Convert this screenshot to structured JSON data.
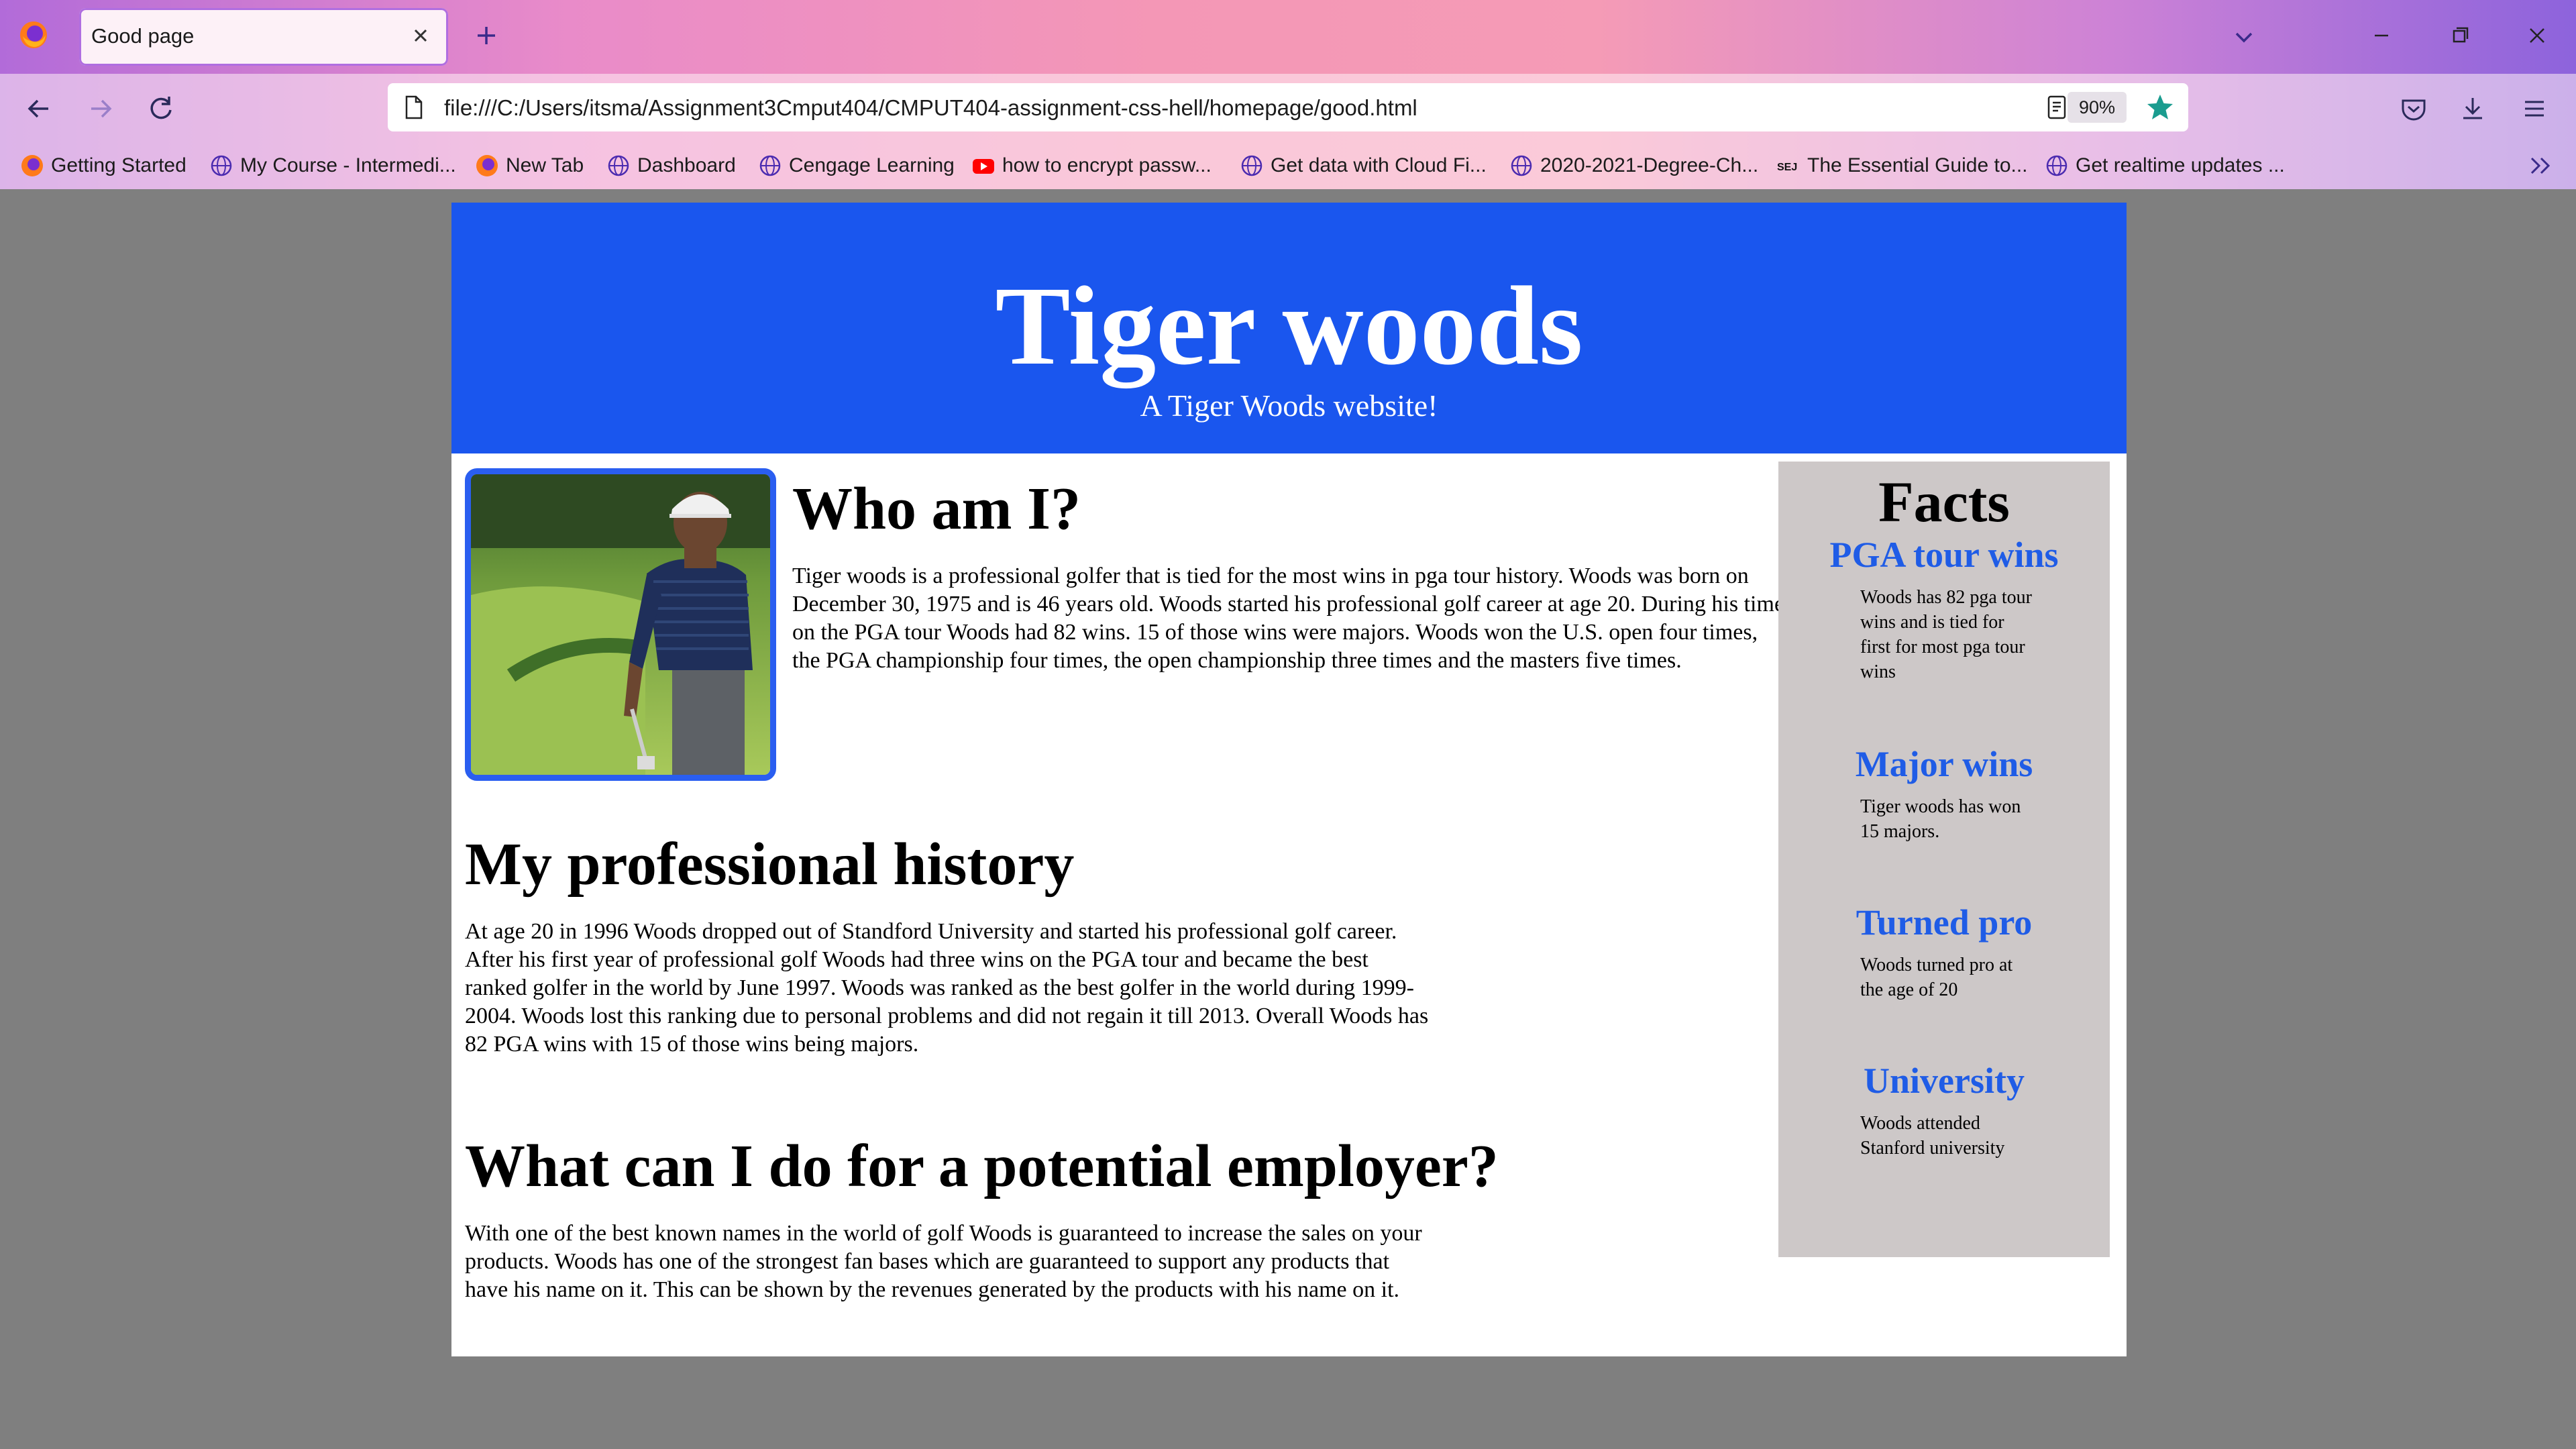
{
  "browser": {
    "tab_title": "Good page",
    "url": "file:///C:/Users/itsma/Assignment3Cmput404/CMPUT404-assignment-css-hell/homepage/good.html",
    "zoom": "90%",
    "bookmarks": [
      {
        "label": "Getting Started",
        "icon": "firefox-icon"
      },
      {
        "label": "My Course - Intermedi...",
        "icon": "globe-icon"
      },
      {
        "label": "New Tab",
        "icon": "firefox-icon"
      },
      {
        "label": "Dashboard",
        "icon": "globe-icon"
      },
      {
        "label": "Cengage Learning",
        "icon": "globe-icon"
      },
      {
        "label": "how to encrypt passw...",
        "icon": "youtube-icon"
      },
      {
        "label": "Get data with Cloud Fi...",
        "icon": "globe-icon"
      },
      {
        "label": "2020-2021-Degree-Ch...",
        "icon": "globe-icon"
      },
      {
        "label": "The Essential Guide to...",
        "icon": "sej-icon"
      },
      {
        "label": "Get realtime updates ...",
        "icon": "globe-icon"
      }
    ],
    "sej_glyph": "SEJ",
    "accent_colors": {
      "star": "#1a9c8f",
      "tab_outline": "#b06ee0"
    }
  },
  "page": {
    "header": {
      "title": "Tiger woods",
      "subtitle": "A Tiger Woods website!",
      "background": "#1a56ee"
    },
    "who": {
      "title": "Who am I?",
      "text": "Tiger woods is a professional golfer that is tied for the most wins in pga tour history. Woods was born on December 30, 1975 and is 46 years old. Woods started his professional golf career at age 20. During his time on the PGA tour Woods had 82 wins. 15 of those wins were majors. Woods won the U.S. open four times, the PGA championship four times, the open championship three times and the masters five times."
    },
    "history": {
      "title": "My professional history",
      "text": "At age 20 in 1996 Woods dropped out of Standford University and started his professional golf career. After his first year of professional golf Woods had three wins on the PGA tour and became the best ranked golfer in the world by June 1997. Woods was ranked as the best golfer in the world during 1999-2004. Woods lost this ranking due to personal problems and did not regain it till 2013. Overall Woods has 82 PGA wins with 15 of those wins being majors."
    },
    "employer": {
      "title": "What can I do for a potential employer?",
      "text": "With one of the best known names in the world of golf Woods is guaranteed to increase the sales on your products. Woods has one of the strongest fan bases which are guaranteed to support any products that have his name on it. This can be shown by the revenues generated by the products with his name on it."
    },
    "facts": {
      "title": "Facts",
      "items": [
        {
          "heading": "PGA tour wins",
          "text": "Woods has 82 pga tour wins and is tied for first for most pga tour wins"
        },
        {
          "heading": "Major wins",
          "text": "Tiger woods has won 15 majors."
        },
        {
          "heading": "Turned pro",
          "text": "Woods turned pro at the age of 20"
        },
        {
          "heading": "University",
          "text": "Woods attended Stanford university"
        }
      ]
    }
  }
}
